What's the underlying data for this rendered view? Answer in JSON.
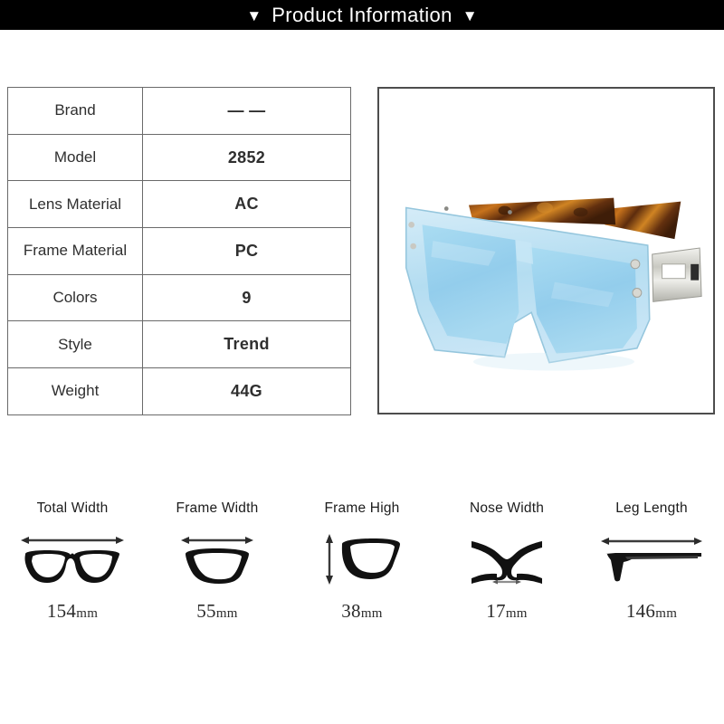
{
  "header": {
    "left_triangle": "▼",
    "title": "Product Information",
    "right_triangle": "▼",
    "background": "#000000",
    "text_color": "#ffffff"
  },
  "spec_table": {
    "rows": [
      {
        "label": "Brand",
        "value": "— —"
      },
      {
        "label": "Model",
        "value": "2852"
      },
      {
        "label": "Lens Material",
        "value": "AC"
      },
      {
        "label": "Frame Material",
        "value": "PC"
      },
      {
        "label": "Colors",
        "value": "9"
      },
      {
        "label": "Style",
        "value": "Trend"
      },
      {
        "label": "Weight",
        "value": "44G"
      }
    ],
    "border_color": "#6a6a6a"
  },
  "product_image": {
    "name": "sunglasses-photo",
    "description": "Blue transparent square sunglasses with tortoiseshell temples and silver metal hinges",
    "lens_color": "#9fd4ef",
    "frame_color": "#bfe2f4",
    "temple_color": "#7a3b12",
    "hinge_color": "#d6d6d0",
    "border_color": "#4d4d4d"
  },
  "measurements": [
    {
      "title": "Total Width",
      "value": "154",
      "unit": "mm",
      "icon": "full-glasses-horizontal-icon"
    },
    {
      "title": "Frame Width",
      "value": "55",
      "unit": "mm",
      "icon": "single-lens-horizontal-icon"
    },
    {
      "title": "Frame High",
      "value": "38",
      "unit": "mm",
      "icon": "single-lens-vertical-icon"
    },
    {
      "title": "Nose Width",
      "value": "17",
      "unit": "mm",
      "icon": "nose-bridge-icon"
    },
    {
      "title": "Leg Length",
      "value": "146",
      "unit": "mm",
      "icon": "temple-arm-icon"
    }
  ]
}
